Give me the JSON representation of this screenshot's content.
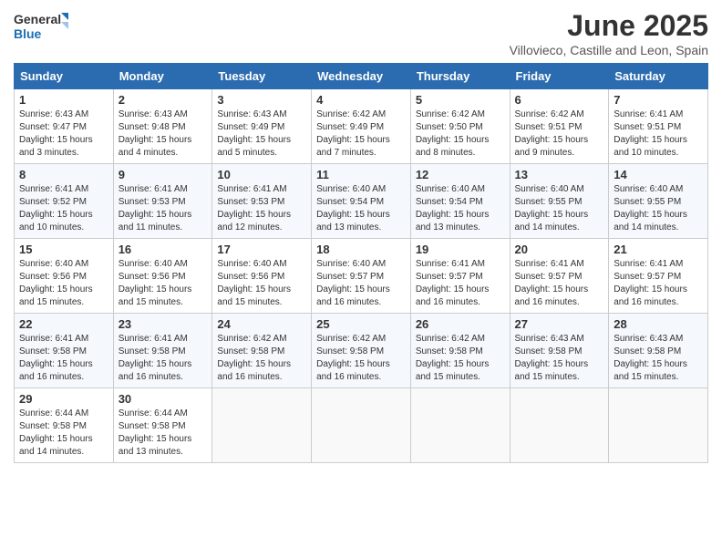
{
  "header": {
    "logo_general": "General",
    "logo_blue": "Blue",
    "title": "June 2025",
    "subtitle": "Villovieco, Castille and Leon, Spain"
  },
  "columns": [
    "Sunday",
    "Monday",
    "Tuesday",
    "Wednesday",
    "Thursday",
    "Friday",
    "Saturday"
  ],
  "weeks": [
    [
      {
        "day": "1",
        "sunrise": "Sunrise: 6:43 AM",
        "sunset": "Sunset: 9:47 PM",
        "daylight": "Daylight: 15 hours and 3 minutes."
      },
      {
        "day": "2",
        "sunrise": "Sunrise: 6:43 AM",
        "sunset": "Sunset: 9:48 PM",
        "daylight": "Daylight: 15 hours and 4 minutes."
      },
      {
        "day": "3",
        "sunrise": "Sunrise: 6:43 AM",
        "sunset": "Sunset: 9:49 PM",
        "daylight": "Daylight: 15 hours and 5 minutes."
      },
      {
        "day": "4",
        "sunrise": "Sunrise: 6:42 AM",
        "sunset": "Sunset: 9:49 PM",
        "daylight": "Daylight: 15 hours and 7 minutes."
      },
      {
        "day": "5",
        "sunrise": "Sunrise: 6:42 AM",
        "sunset": "Sunset: 9:50 PM",
        "daylight": "Daylight: 15 hours and 8 minutes."
      },
      {
        "day": "6",
        "sunrise": "Sunrise: 6:42 AM",
        "sunset": "Sunset: 9:51 PM",
        "daylight": "Daylight: 15 hours and 9 minutes."
      },
      {
        "day": "7",
        "sunrise": "Sunrise: 6:41 AM",
        "sunset": "Sunset: 9:51 PM",
        "daylight": "Daylight: 15 hours and 10 minutes."
      }
    ],
    [
      {
        "day": "8",
        "sunrise": "Sunrise: 6:41 AM",
        "sunset": "Sunset: 9:52 PM",
        "daylight": "Daylight: 15 hours and 10 minutes."
      },
      {
        "day": "9",
        "sunrise": "Sunrise: 6:41 AM",
        "sunset": "Sunset: 9:53 PM",
        "daylight": "Daylight: 15 hours and 11 minutes."
      },
      {
        "day": "10",
        "sunrise": "Sunrise: 6:41 AM",
        "sunset": "Sunset: 9:53 PM",
        "daylight": "Daylight: 15 hours and 12 minutes."
      },
      {
        "day": "11",
        "sunrise": "Sunrise: 6:40 AM",
        "sunset": "Sunset: 9:54 PM",
        "daylight": "Daylight: 15 hours and 13 minutes."
      },
      {
        "day": "12",
        "sunrise": "Sunrise: 6:40 AM",
        "sunset": "Sunset: 9:54 PM",
        "daylight": "Daylight: 15 hours and 13 minutes."
      },
      {
        "day": "13",
        "sunrise": "Sunrise: 6:40 AM",
        "sunset": "Sunset: 9:55 PM",
        "daylight": "Daylight: 15 hours and 14 minutes."
      },
      {
        "day": "14",
        "sunrise": "Sunrise: 6:40 AM",
        "sunset": "Sunset: 9:55 PM",
        "daylight": "Daylight: 15 hours and 14 minutes."
      }
    ],
    [
      {
        "day": "15",
        "sunrise": "Sunrise: 6:40 AM",
        "sunset": "Sunset: 9:56 PM",
        "daylight": "Daylight: 15 hours and 15 minutes."
      },
      {
        "day": "16",
        "sunrise": "Sunrise: 6:40 AM",
        "sunset": "Sunset: 9:56 PM",
        "daylight": "Daylight: 15 hours and 15 minutes."
      },
      {
        "day": "17",
        "sunrise": "Sunrise: 6:40 AM",
        "sunset": "Sunset: 9:56 PM",
        "daylight": "Daylight: 15 hours and 15 minutes."
      },
      {
        "day": "18",
        "sunrise": "Sunrise: 6:40 AM",
        "sunset": "Sunset: 9:57 PM",
        "daylight": "Daylight: 15 hours and 16 minutes."
      },
      {
        "day": "19",
        "sunrise": "Sunrise: 6:41 AM",
        "sunset": "Sunset: 9:57 PM",
        "daylight": "Daylight: 15 hours and 16 minutes."
      },
      {
        "day": "20",
        "sunrise": "Sunrise: 6:41 AM",
        "sunset": "Sunset: 9:57 PM",
        "daylight": "Daylight: 15 hours and 16 minutes."
      },
      {
        "day": "21",
        "sunrise": "Sunrise: 6:41 AM",
        "sunset": "Sunset: 9:57 PM",
        "daylight": "Daylight: 15 hours and 16 minutes."
      }
    ],
    [
      {
        "day": "22",
        "sunrise": "Sunrise: 6:41 AM",
        "sunset": "Sunset: 9:58 PM",
        "daylight": "Daylight: 15 hours and 16 minutes."
      },
      {
        "day": "23",
        "sunrise": "Sunrise: 6:41 AM",
        "sunset": "Sunset: 9:58 PM",
        "daylight": "Daylight: 15 hours and 16 minutes."
      },
      {
        "day": "24",
        "sunrise": "Sunrise: 6:42 AM",
        "sunset": "Sunset: 9:58 PM",
        "daylight": "Daylight: 15 hours and 16 minutes."
      },
      {
        "day": "25",
        "sunrise": "Sunrise: 6:42 AM",
        "sunset": "Sunset: 9:58 PM",
        "daylight": "Daylight: 15 hours and 16 minutes."
      },
      {
        "day": "26",
        "sunrise": "Sunrise: 6:42 AM",
        "sunset": "Sunset: 9:58 PM",
        "daylight": "Daylight: 15 hours and 15 minutes."
      },
      {
        "day": "27",
        "sunrise": "Sunrise: 6:43 AM",
        "sunset": "Sunset: 9:58 PM",
        "daylight": "Daylight: 15 hours and 15 minutes."
      },
      {
        "day": "28",
        "sunrise": "Sunrise: 6:43 AM",
        "sunset": "Sunset: 9:58 PM",
        "daylight": "Daylight: 15 hours and 15 minutes."
      }
    ],
    [
      {
        "day": "29",
        "sunrise": "Sunrise: 6:44 AM",
        "sunset": "Sunset: 9:58 PM",
        "daylight": "Daylight: 15 hours and 14 minutes."
      },
      {
        "day": "30",
        "sunrise": "Sunrise: 6:44 AM",
        "sunset": "Sunset: 9:58 PM",
        "daylight": "Daylight: 15 hours and 13 minutes."
      },
      null,
      null,
      null,
      null,
      null
    ]
  ]
}
